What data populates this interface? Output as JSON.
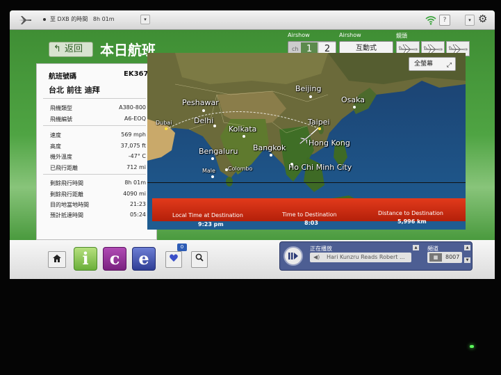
{
  "topbar": {
    "flight_status": "至 DXB 的時間",
    "time_remaining": "8h 01m",
    "dropdown_glyph": "▾",
    "help_label": "?",
    "settings_glyph": "⚙"
  },
  "header": {
    "back_label": "返回",
    "title": "本日航班",
    "airshow_label_1": "Airshow",
    "airshow_label_2": "Airshow",
    "lens_label": "鏡頭",
    "ch_label": "ch",
    "ch_1": "1",
    "ch_2": "2",
    "interactive_label": "互動式"
  },
  "flight_info": {
    "flight_number_label": "航班號碼",
    "flight_number": "EK367",
    "route": "台北 前往 迪拜",
    "rows_a": [
      {
        "label": "飛機類型",
        "value": "A380-800"
      },
      {
        "label": "飛機編號",
        "value": "A6-EOQ"
      }
    ],
    "rows_b": [
      {
        "label": "速度",
        "value": "569 mph"
      },
      {
        "label": "高度",
        "value": "37,075 ft"
      },
      {
        "label": "機外溫度",
        "value": "-47° C"
      },
      {
        "label": "已飛行距離",
        "value": "712 mi"
      }
    ],
    "rows_c": [
      {
        "label": "剩餘飛行時間",
        "value": "8h 01m"
      },
      {
        "label": "剩餘飛行距離",
        "value": "4090 mi"
      },
      {
        "label": "目的地當地時間",
        "value": "21:23"
      },
      {
        "label": "預計抵達時間",
        "value": "05:24"
      }
    ]
  },
  "map": {
    "fullscreen_label": "全螢幕",
    "cities": {
      "beijing": "Beijing",
      "osaka": "Osaka",
      "peshawar": "Peshawar",
      "dubai": "Dubai",
      "delhi": "Delhi",
      "kolkata": "Kolkata",
      "taipei": "Taipei",
      "hongkong": "Hong Kong",
      "bengaluru": "Bengaluru",
      "bangkok": "Bangkok",
      "male": "Male",
      "colombo": "Colombo",
      "hochiminh": "Ho Chi Minh City"
    }
  },
  "destination_bar": {
    "local_time_label": "Local Time at Destination",
    "local_time_value": "9:23 pm",
    "time_to_label": "Time to Destination",
    "time_to_value": "8:03",
    "distance_label": "Distance to Destination",
    "distance_value": "5,996 km"
  },
  "bottom": {
    "app_i": "i",
    "app_c": "c",
    "app_e": "e",
    "favorites_count": "0",
    "now_playing_label": "正在播放",
    "now_playing_track": "Hari Kunzru Reads Robert ...",
    "channel_label": "頻道",
    "channel_grid": "▦",
    "channel_value": "8007"
  },
  "colors": {
    "screen_green": "#4a9a3e",
    "destination_red": "#d12f14",
    "player_blue": "#4d5e93",
    "app_i": "#7cc24a",
    "app_c": "#8a2d8e",
    "app_e": "#3a4fa8"
  }
}
